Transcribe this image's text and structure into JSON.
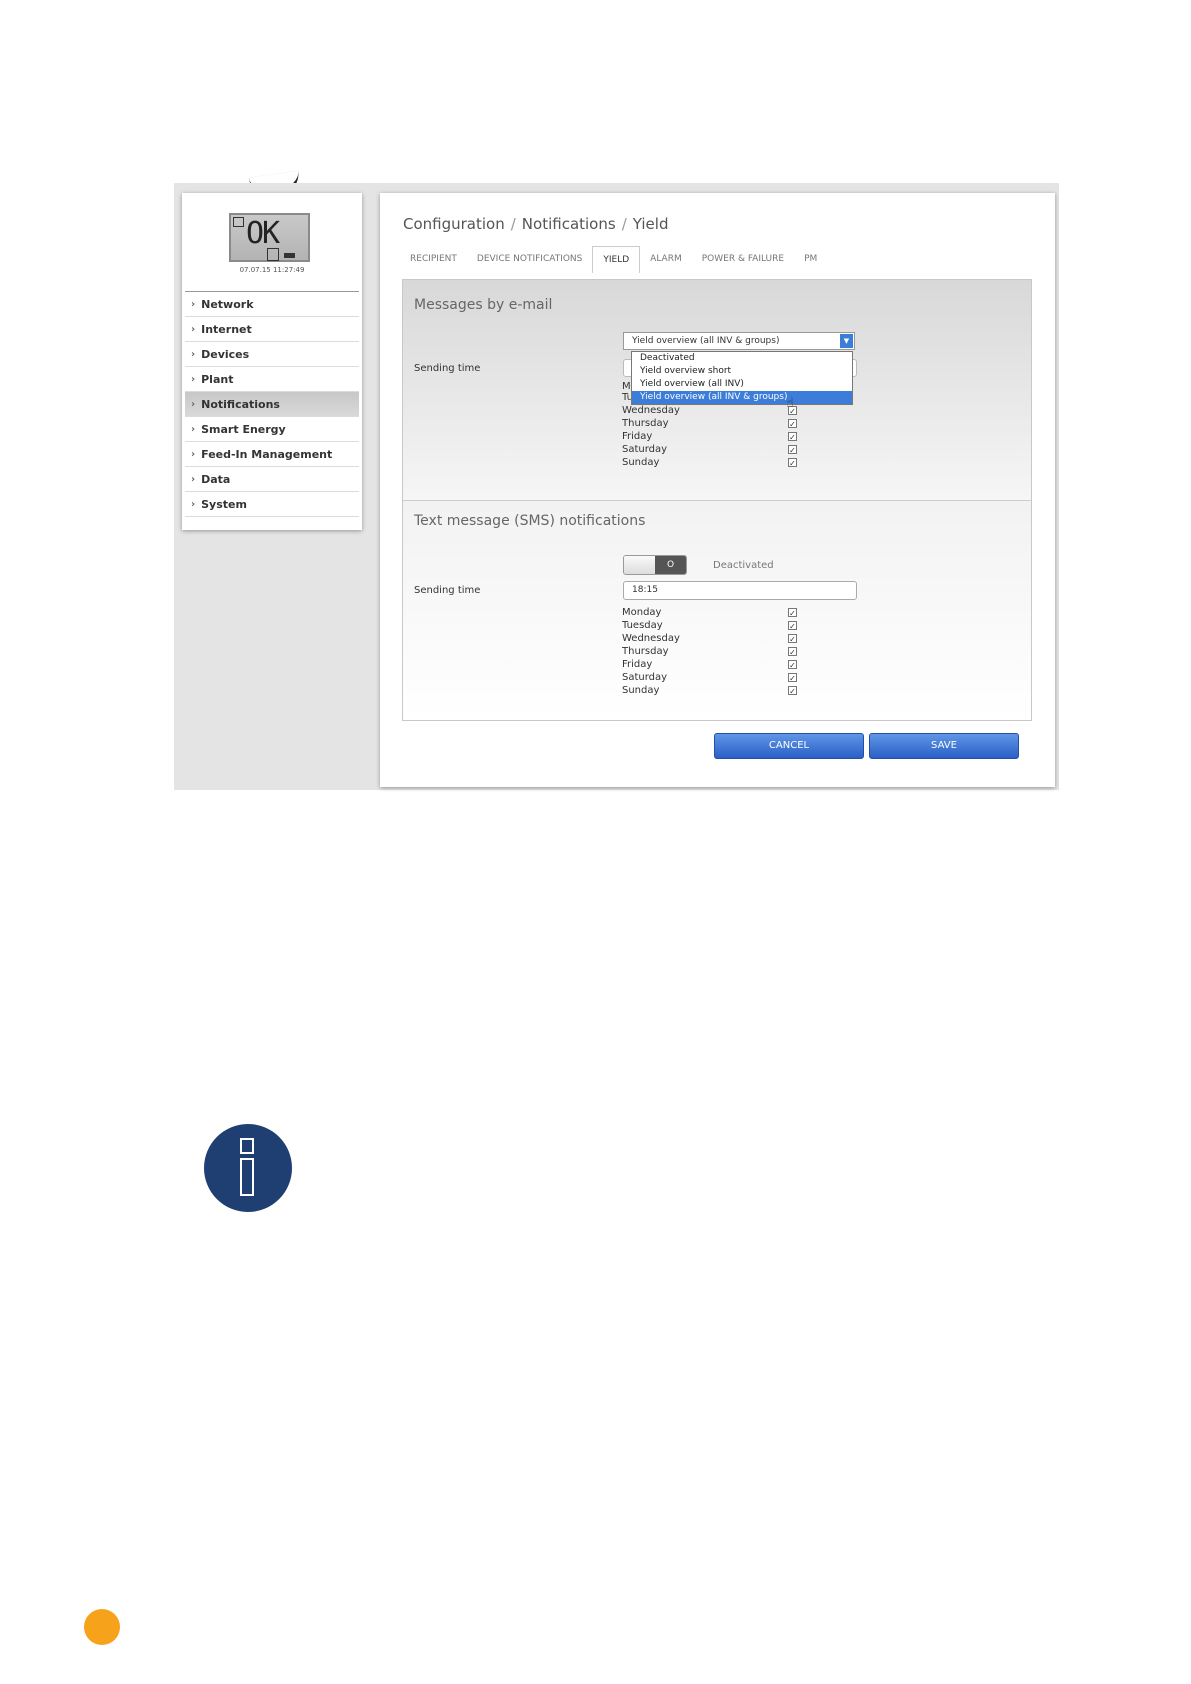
{
  "lcd": {
    "text": "OK",
    "datetime": "07.07.15 11:27:49"
  },
  "sidebar": {
    "items": [
      {
        "label": "Network"
      },
      {
        "label": "Internet"
      },
      {
        "label": "Devices"
      },
      {
        "label": "Plant"
      },
      {
        "label": "Notifications",
        "active": true
      },
      {
        "label": "Smart Energy"
      },
      {
        "label": "Feed-In Management"
      },
      {
        "label": "Data"
      },
      {
        "label": "System"
      }
    ]
  },
  "breadcrumb": {
    "part1": "Configuration",
    "part2": "Notifications",
    "part3": "Yield",
    "separator": "/"
  },
  "tabs": [
    {
      "label": "RECIPIENT"
    },
    {
      "label": "DEVICE NOTIFICATIONS"
    },
    {
      "label": "YIELD",
      "active": true
    },
    {
      "label": "ALARM"
    },
    {
      "label": "POWER & FAILURE"
    },
    {
      "label": "PM"
    }
  ],
  "email_section": {
    "title": "Messages by e-mail",
    "sending_time_label": "Sending time",
    "select_value": "Yield overview (all INV & groups)",
    "dropdown_options": [
      "Deactivated",
      "Yield overview short",
      "Yield overview (all INV)",
      "Yield overview (all INV & groups)"
    ],
    "selected_option_index": 3,
    "days_visible": [
      "Tuesday",
      "Wednesday",
      "Thursday",
      "Friday",
      "Saturday",
      "Sunday"
    ],
    "partial_day_letter": "M"
  },
  "sms_section": {
    "title": "Text message (SMS) notifications",
    "toggle_state": "Deactivated",
    "toggle_knob": "O",
    "sending_time_label": "Sending time",
    "sending_time_value": "18:15",
    "days": [
      "Monday",
      "Tuesday",
      "Wednesday",
      "Thursday",
      "Friday",
      "Saturday",
      "Sunday"
    ]
  },
  "checkbox_mark": "✓",
  "buttons": {
    "cancel": "CANCEL",
    "save": "SAVE"
  },
  "colors": {
    "accent": "#3b7dd8",
    "button": "#2a5fc7",
    "info_icon": "#1f3f72",
    "page_marker": "#f7a21b"
  }
}
